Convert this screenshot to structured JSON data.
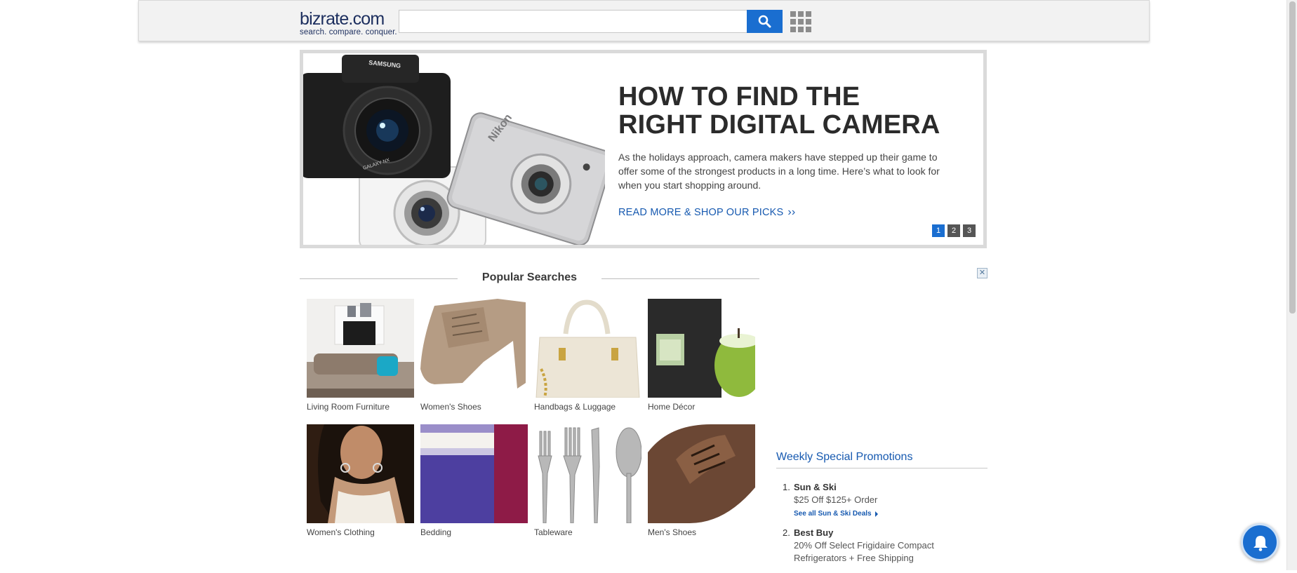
{
  "header": {
    "logo_brand": "bizrate.com",
    "logo_tagline": "search. compare. conquer.",
    "search_placeholder": "",
    "search_icon": "magnifier-icon",
    "apps_icon": "grid-icon"
  },
  "hero": {
    "title_line1": "HOW TO FIND THE",
    "title_line2": "RIGHT DIGITAL CAMERA",
    "description": "As the holidays approach, camera makers have stepped up their game to offer some of the strongest products in a long time. Here’s what to look for when you start shopping around.",
    "cta_label": "READ MORE & SHOP OUR PICKS",
    "cta_chevron": "››",
    "pages": [
      "1",
      "2",
      "3"
    ],
    "active_page": "1"
  },
  "popular": {
    "title": "Popular Searches",
    "tiles": [
      {
        "label": "Living Room Furniture"
      },
      {
        "label": "Women's Shoes"
      },
      {
        "label": "Handbags & Luggage"
      },
      {
        "label": "Home Décor"
      },
      {
        "label": "Women's Clothing"
      },
      {
        "label": "Bedding"
      },
      {
        "label": "Tableware"
      },
      {
        "label": "Men's Shoes"
      }
    ]
  },
  "ad": {
    "close_glyph": "✕"
  },
  "promotions": {
    "title": "Weekly Special Promotions",
    "items": [
      {
        "num": "1.",
        "store": "Sun & Ski",
        "offer": "$25 Off $125+ Order",
        "deals_link": "See all Sun & Ski Deals"
      },
      {
        "num": "2.",
        "store": "Best Buy",
        "offer": "20% Off Select Frigidaire Compact Refrigerators + Free Shipping",
        "deals_link": ""
      }
    ]
  },
  "colors": {
    "accent": "#1a6ed0",
    "link": "#1659b0",
    "brand": "#1c2e5e"
  }
}
